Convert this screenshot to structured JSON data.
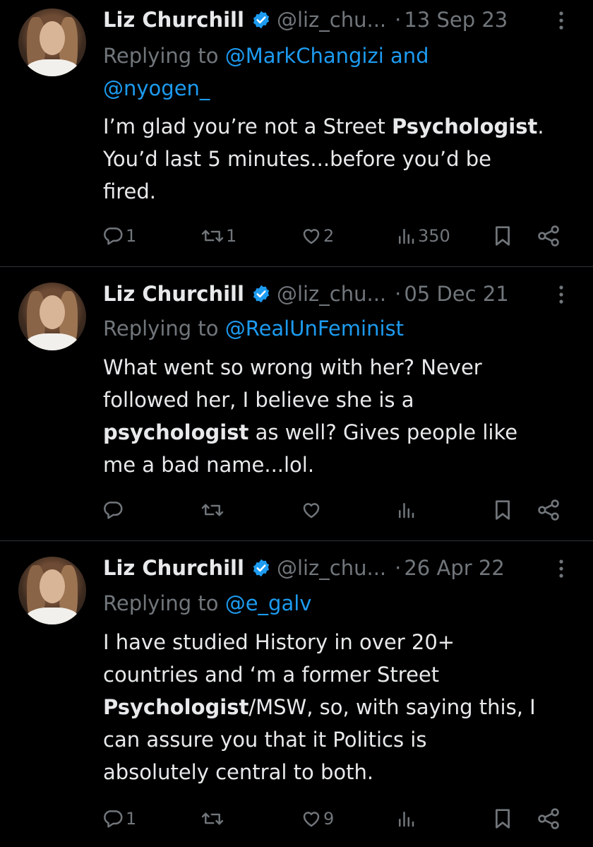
{
  "tweets": [
    {
      "author": "Liz Churchill",
      "handle": "@liz_chu...",
      "date": "13 Sep 23",
      "replying_prefix": "Replying to ",
      "replying_to_1": "@MarkChangizi",
      "replying_joiner": " and",
      "replying_to_2": "@nyogen_",
      "body": {
        "l1a": "I’m glad you’re not a Street ",
        "l1b": "Psychologist",
        "l1c": ".",
        "l2": "You’d last 5 minutes...before you’d be",
        "l3": "fired."
      },
      "replies": "1",
      "reposts": "1",
      "likes": "2",
      "views": "350"
    },
    {
      "author": "Liz Churchill",
      "handle": "@liz_chu...",
      "date": "05 Dec 21",
      "replying_prefix": "Replying to ",
      "replying_to_1": "@RealUnFeminist",
      "body": {
        "l1": "What went so wrong with her? Never",
        "l2": "followed her, I believe she is a",
        "l3a": "psychologist",
        "l3b": " as well? Gives people like",
        "l4": "me a bad name...lol."
      },
      "replies": "",
      "reposts": "",
      "likes": "",
      "views": ""
    },
    {
      "author": "Liz Churchill",
      "handle": "@liz_chu...",
      "date": "26 Apr 22",
      "replying_prefix": "Replying to ",
      "replying_to_1": "@e_galv",
      "body": {
        "l1": "I have studied History in over 20+",
        "l2": "countries and ‘m a former Street",
        "l3a": "Psychologist",
        "l3b": "/MSW, so, with saying this, I",
        "l4": "can assure you that it Politics is",
        "l5": "absolutely central to both."
      },
      "replies": "1",
      "reposts": "",
      "likes": "9",
      "views": ""
    }
  ],
  "colors": {
    "background": "#000000",
    "text": "#e7e9ea",
    "muted": "#71767b",
    "link": "#1d9bf0",
    "verified": "#1d9bf0"
  },
  "icons": [
    "reply-icon",
    "repost-icon",
    "like-icon",
    "views-icon",
    "bookmark-icon",
    "share-icon",
    "verified-badge-icon",
    "more-icon"
  ]
}
